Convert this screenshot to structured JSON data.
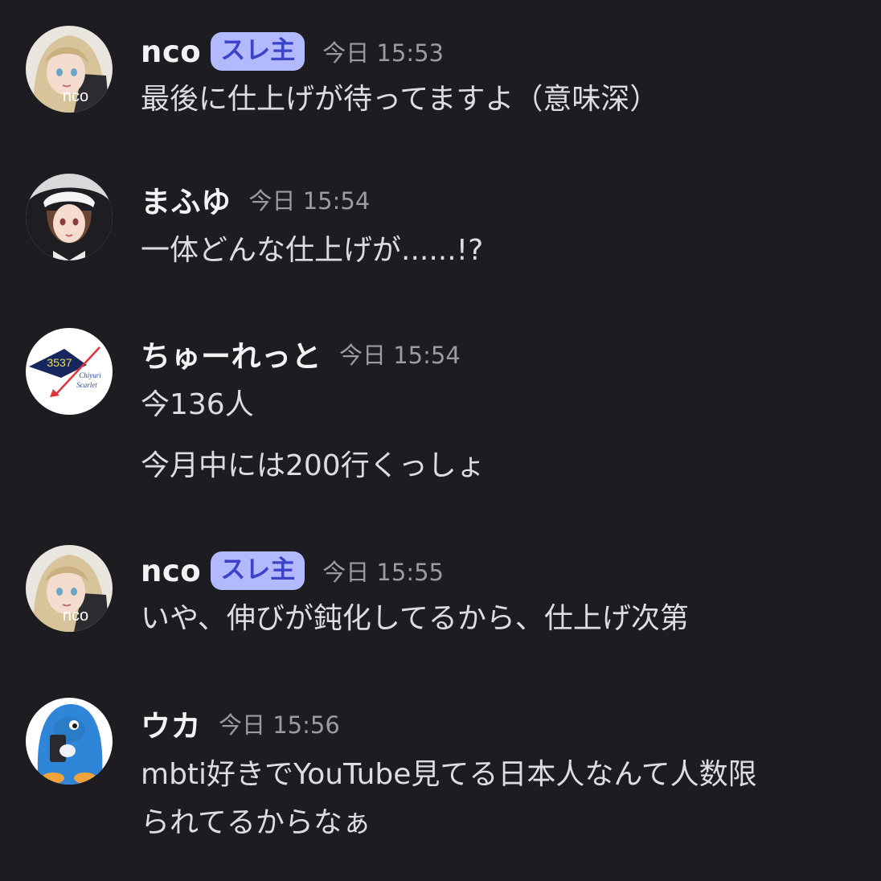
{
  "messages": [
    {
      "author": "nco",
      "badge": "スレ主",
      "time": "今日 15:53",
      "avatar_label": "nco",
      "lines": [
        "最後に仕上げが待ってますよ（意味深）"
      ]
    },
    {
      "author": "まふゆ",
      "badge": "",
      "time": "今日 15:54",
      "lines": [
        "一体どんな仕上げが......!?"
      ]
    },
    {
      "author": "ちゅーれっと",
      "badge": "",
      "time": "今日 15:54",
      "avatar_number": "3537",
      "avatar_text_1": "Chiyuri",
      "avatar_text_2": "Scarlet",
      "lines": [
        "今136人",
        "今月中には200行くっしょ"
      ]
    },
    {
      "author": "nco",
      "badge": "スレ主",
      "time": "今日 15:55",
      "avatar_label": "nco",
      "lines": [
        "いや、伸びが鈍化してるから、仕上げ次第"
      ]
    },
    {
      "author": "ウカ",
      "badge": "",
      "time": "今日 15:56",
      "lines": [
        "mbti好きでYouTube見てる日本人なんて人数限",
        "られてるからなぁ"
      ]
    }
  ],
  "colors": {
    "background": "#1c1c21",
    "name": "#f2f3f5",
    "text": "#dcdde1",
    "timestamp": "#9a9ca3",
    "badge_bg": "#b3b9ff",
    "badge_text": "#3b44c8"
  },
  "icons": {
    "avatar_nco": "anime-girl-avatar",
    "avatar_mafuyu": "nun-girl-avatar",
    "avatar_chuuretto": "scarlet-logo-avatar",
    "avatar_uka": "blue-penguin-avatar"
  }
}
